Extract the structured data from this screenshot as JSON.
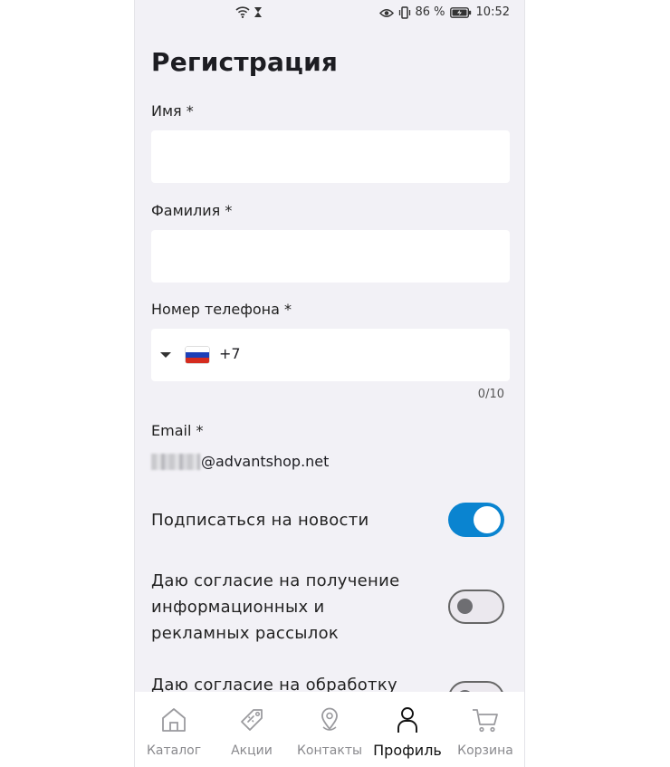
{
  "status_bar": {
    "battery": "86 %",
    "time": "10:52"
  },
  "page": {
    "title": "Регистрация"
  },
  "form": {
    "first_name_label": "Имя *",
    "first_name_value": "",
    "last_name_label": "Фамилия *",
    "last_name_value": "",
    "phone_label": "Номер телефона *",
    "phone_country": "RU",
    "phone_code": "+7",
    "phone_counter": "0/10",
    "email_label": "Email *",
    "email_domain": "@advantshop.net"
  },
  "toggles": [
    {
      "label": "Подписаться на новости",
      "on": true
    },
    {
      "label": "Даю согласие на получение информационных и рекламных рассылок",
      "on": false
    },
    {
      "label": "Даю согласие на обработку",
      "on": false
    }
  ],
  "bottom_nav": {
    "items": [
      {
        "label": "Каталог",
        "icon": "home-icon",
        "active": false
      },
      {
        "label": "Акции",
        "icon": "tag-icon",
        "active": false
      },
      {
        "label": "Контакты",
        "icon": "location-pin-icon",
        "active": false
      },
      {
        "label": "Профиль",
        "icon": "person-icon",
        "active": true
      },
      {
        "label": "Корзина",
        "icon": "cart-icon",
        "active": false
      }
    ]
  },
  "colors": {
    "accent": "#0a84d0",
    "background": "#f2f1f6",
    "toggle_off_knob": "#6e6e72"
  }
}
